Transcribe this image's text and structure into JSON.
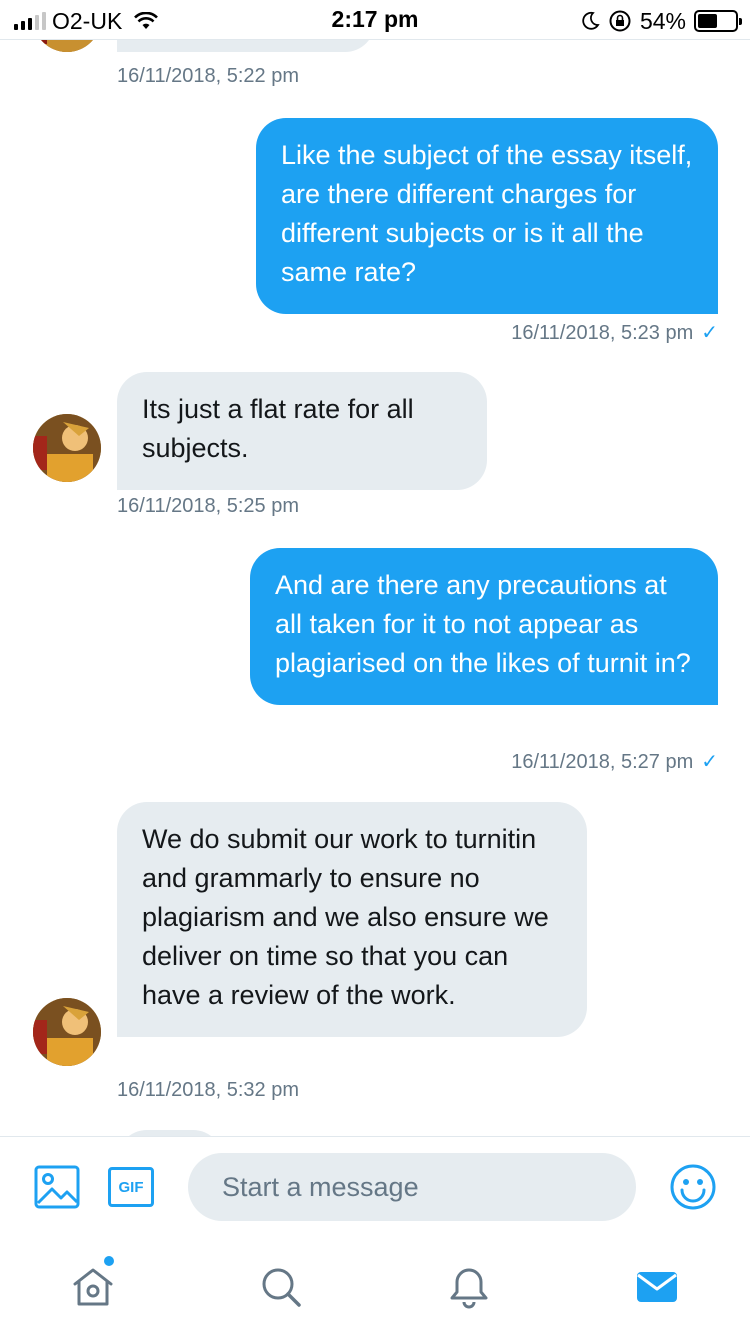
{
  "status_bar": {
    "carrier": "O2-UK",
    "time": "2:17 pm",
    "battery": "54%",
    "battery_level": 0.54,
    "icons": [
      "signal-icon",
      "wifi-icon",
      "moon-icon",
      "rotation-lock-icon",
      "battery-icon"
    ]
  },
  "conversation": {
    "messages": [
      {
        "direction": "incoming",
        "text": "",
        "timestamp": "16/11/2018, 5:22 pm"
      },
      {
        "direction": "outgoing",
        "text": "Like the subject of the essay itself, are there different charges for different subjects or is it all the same rate?",
        "timestamp": "16/11/2018, 5:23 pm",
        "status": "✓"
      },
      {
        "direction": "incoming",
        "text": "Its just a flat rate for all subjects.",
        "timestamp": "16/11/2018, 5:25 pm"
      },
      {
        "direction": "outgoing",
        "text": "And are there any precautions at all taken for it to not appear as plagiarised on the likes of turnit in?",
        "timestamp": "16/11/2018, 5:27 pm",
        "status": "✓"
      },
      {
        "direction": "incoming",
        "text": "We do submit our work to turnitin and grammarly to ensure no plagiarism and we also ensure we deliver on time so that you can have a review of the work.",
        "timestamp": "16/11/2018, 5:32 pm"
      }
    ]
  },
  "composer": {
    "placeholder": "Start a message",
    "gif_label": "GIF",
    "icons": [
      "image-icon",
      "gif-icon",
      "emoji-icon"
    ]
  },
  "tab_bar": {
    "tabs": [
      "home",
      "search",
      "notifications",
      "messages"
    ],
    "active": "messages",
    "home_has_new": true
  },
  "colors": {
    "accent": "#1da1f2",
    "incoming_bubble": "#e6ecf0",
    "timestamp": "#657786",
    "icon_gray": "#657786"
  }
}
